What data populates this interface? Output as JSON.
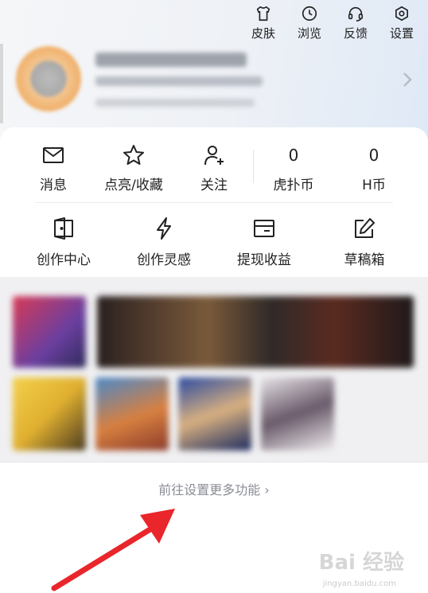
{
  "top_actions": [
    {
      "label": "皮肤",
      "icon": "tshirt-icon"
    },
    {
      "label": "浏览",
      "icon": "clock-icon"
    },
    {
      "label": "反馈",
      "icon": "headset-icon"
    },
    {
      "label": "设置",
      "icon": "gear-icon"
    }
  ],
  "stats": [
    {
      "label": "消息",
      "icon": "mail-icon"
    },
    {
      "label": "点亮/收藏",
      "icon": "star-icon"
    },
    {
      "label": "关注",
      "icon": "user-plus-icon"
    },
    {
      "label": "虎扑币",
      "value": "0"
    },
    {
      "label": "H币",
      "value": "0"
    }
  ],
  "tools": [
    {
      "label": "创作中心",
      "icon": "door-icon"
    },
    {
      "label": "创作灵感",
      "icon": "lightning-icon"
    },
    {
      "label": "提现收益",
      "icon": "wallet-icon"
    },
    {
      "label": "草稿箱",
      "icon": "edit-icon"
    }
  ],
  "settings_link": "前往设置更多功能 ›",
  "watermark": "Bai 经验",
  "watermark_sub": "jingyan.baidu.com",
  "colors": {
    "arrow": "#e8262b",
    "link": "#8a8d95"
  }
}
